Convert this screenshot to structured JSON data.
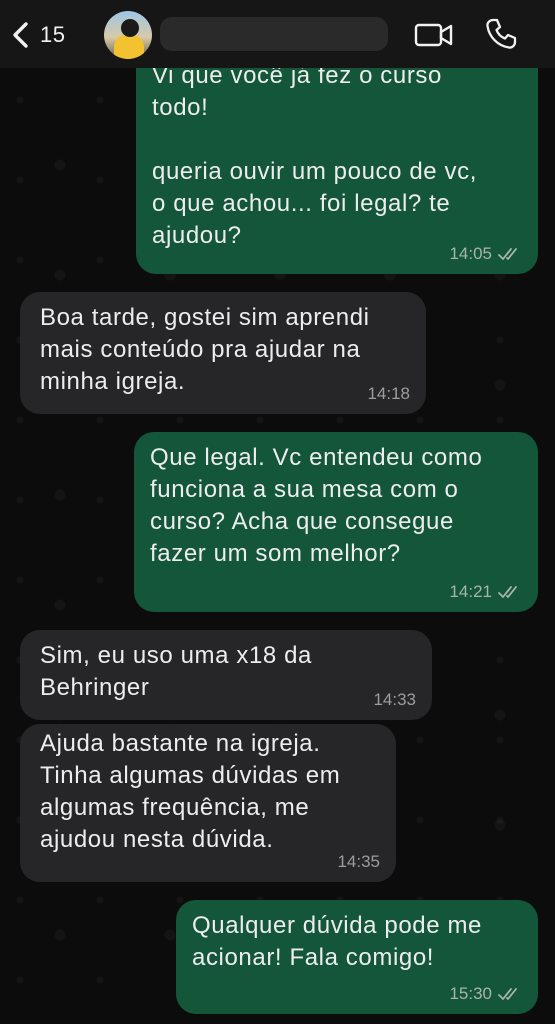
{
  "header": {
    "back_count": "15",
    "contact_name": ""
  },
  "messages": [
    {
      "direction": "outgoing",
      "text": "Vi que você já fez o curso\ntodo!\n\nqueria ouvir um pouco de vc,\no que achou... foi legal? te\najudou?",
      "time": "14:05",
      "status": "read"
    },
    {
      "direction": "incoming",
      "text": "Boa tarde, gostei sim aprendi\nmais conteúdo pra ajudar na\nminha igreja.",
      "time": "14:18"
    },
    {
      "direction": "outgoing",
      "text": "Que legal. Vc entendeu como\nfunciona a sua mesa com o\ncurso? Acha que consegue\nfazer um som melhor?",
      "time": "14:21",
      "status": "read"
    },
    {
      "direction": "incoming",
      "text": "Sim, eu uso uma x18 da\nBehringer",
      "time": "14:33"
    },
    {
      "direction": "incoming",
      "text": "Ajuda bastante na igreja.\nTinha algumas dúvidas em\nalgumas frequência, me\najudou nesta dúvida.",
      "time": "14:35"
    },
    {
      "direction": "outgoing",
      "text": "Qualquer dúvida pode me\nacionar! Fala comigo!",
      "time": "15:30",
      "status": "read"
    }
  ],
  "colors": {
    "outgoing_bubble": "#13563a",
    "incoming_bubble": "#262628",
    "background": "#0c0c0c",
    "header": "#161616"
  },
  "icons": [
    "back-chevron-icon",
    "video-call-icon",
    "voice-call-icon",
    "double-check-icon"
  ]
}
